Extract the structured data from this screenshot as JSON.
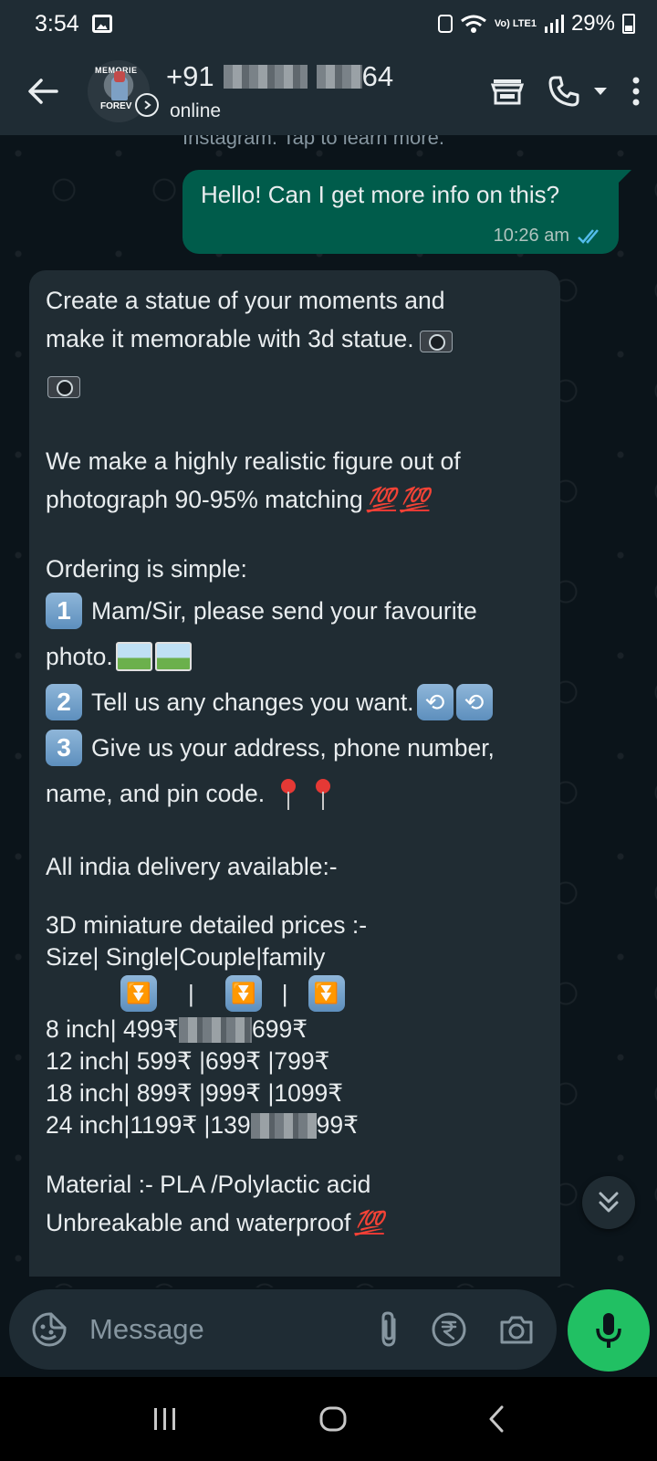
{
  "status_bar": {
    "time": "3:54",
    "network_label": "Vo) LTE1",
    "battery": "29%"
  },
  "header": {
    "contact_prefix": "+91",
    "contact_suffix": "64",
    "presence": "online",
    "avatar_text_top": "MEMORIE",
    "avatar_text_bottom": "FOREV"
  },
  "chat": {
    "system_note": "Instagram. Tap to learn more.",
    "outgoing": {
      "text": "Hello! Can I get more info on this?",
      "time": "10:26 am"
    },
    "incoming": {
      "l1": "Create a statue of your moments and",
      "l2": "make it memorable with 3d statue.",
      "l4": "We make a highly realistic figure out of",
      "l5": "photograph 90-95% matching",
      "emoji_100": "💯",
      "l6": "Ordering is simple:",
      "key1": "1",
      "l7": "Mam/Sir, please send your favourite",
      "l8": "photo.",
      "key2": "2",
      "l9": "Tell us any changes you want.",
      "key3": "3",
      "l10": "Give us your address, phone number,",
      "l11": "name, and pin code.",
      "l12": "All india delivery available:-",
      "l13": "3D miniature detailed prices :-",
      "l14": "Size| Single|Couple|family",
      "sep": "|",
      "down_arrow": "⏬",
      "p1a": "8 inch| 499₹",
      "p1b": "699₹",
      "p2": "12 inch| 599₹ |699₹ |799₹",
      "p3": "18 inch| 899₹ |999₹ |1099₹",
      "p4a": "24 inch|1199₹ |139",
      "p4b": "99₹",
      "l15": "Material :- PLA /Polylactic acid",
      "l16": "Unbreakable and waterproof"
    }
  },
  "composer": {
    "placeholder": "Message"
  },
  "colors": {
    "background": "#0b141a",
    "bar": "#1f2c34",
    "outgoing_bubble": "#005c4b",
    "incoming_bubble": "#202c33",
    "accent_green": "#21c063",
    "read_ticks": "#53bdeb"
  },
  "icons": [
    "back-arrow-icon",
    "store-icon",
    "phone-icon",
    "dropdown-icon",
    "more-vert-icon",
    "sticker-icon",
    "attach-icon",
    "rupee-icon",
    "camera-icon",
    "mic-icon",
    "scroll-down-icon",
    "recents-icon",
    "home-icon",
    "nav-back-icon"
  ]
}
